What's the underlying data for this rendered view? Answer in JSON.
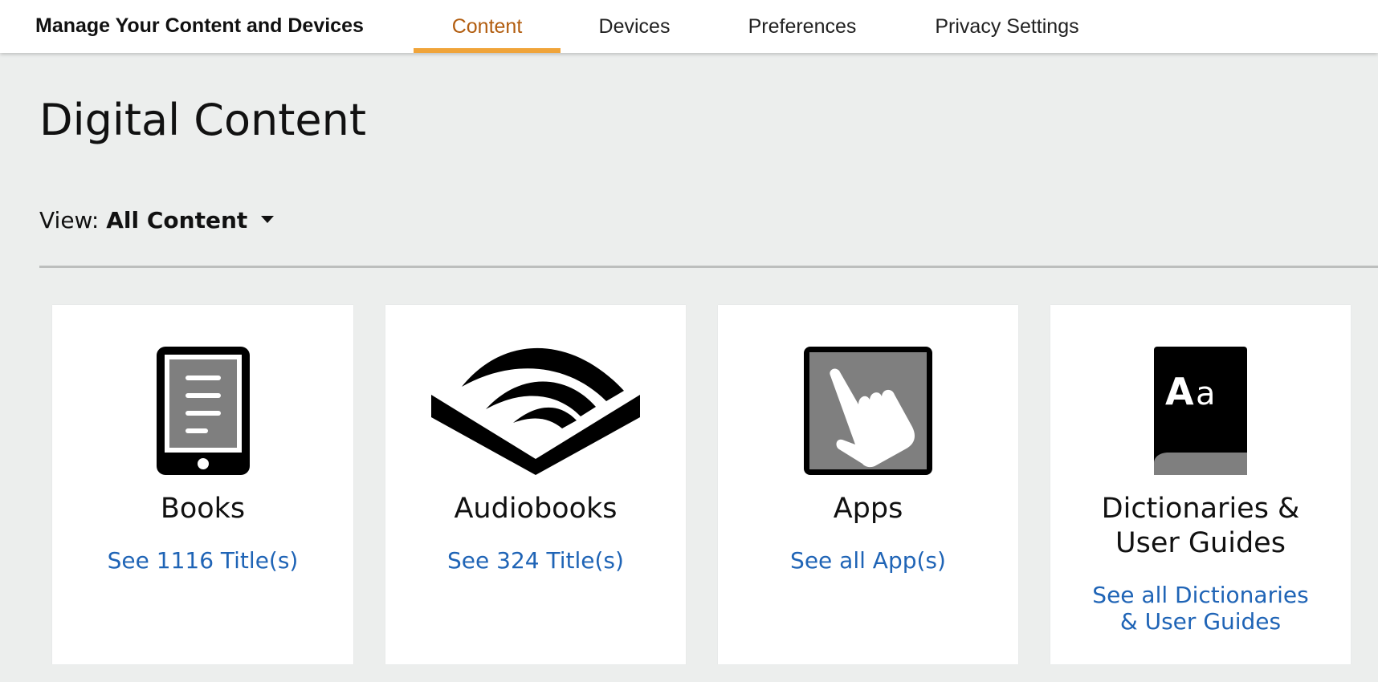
{
  "header": {
    "brand": "Manage Your Content and Devices",
    "tabs": [
      {
        "label": "Content",
        "active": true
      },
      {
        "label": "Devices",
        "active": false
      },
      {
        "label": "Preferences",
        "active": false
      },
      {
        "label": "Privacy Settings",
        "active": false
      }
    ]
  },
  "main": {
    "title": "Digital Content",
    "view": {
      "label": "View:",
      "value": "All Content"
    }
  },
  "cards": [
    {
      "title": "Books",
      "link": "See 1116 Title(s)",
      "icon": "ereader-icon"
    },
    {
      "title": "Audiobooks",
      "link": "See 324 Title(s)",
      "icon": "audible-icon"
    },
    {
      "title": "Apps",
      "link": "See all App(s)",
      "icon": "app-touch-icon"
    },
    {
      "title_line1": "Dictionaries &",
      "title_line2": "User Guides",
      "link_line1": "See all Dictionaries",
      "link_line2": "& User Guides",
      "icon": "dictionary-icon"
    }
  ],
  "colors": {
    "accent": "#f0a43a",
    "active_tab_text": "#b25d0f",
    "link": "#1f64b6",
    "background": "#eceeed"
  }
}
